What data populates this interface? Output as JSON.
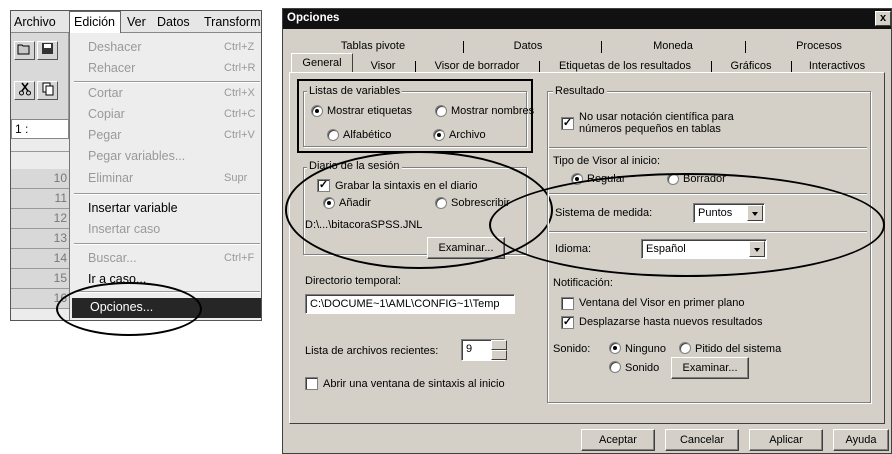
{
  "menubar": {
    "items": [
      "Archivo",
      "Edición",
      "Ver",
      "Datos",
      "Transform"
    ]
  },
  "toolbar_icons": [
    "open-folder-icon",
    "save-icon",
    "cut-icon",
    "copy-icon"
  ],
  "data_editor": {
    "cell_ref": "1 :",
    "row_numbers": [
      "10",
      "11",
      "12",
      "13",
      "14",
      "15",
      "16"
    ]
  },
  "edit_menu": {
    "items": [
      {
        "label": "Deshacer",
        "shortcut": "Ctrl+Z",
        "enabled": false
      },
      {
        "label": "Rehacer",
        "shortcut": "Ctrl+R",
        "enabled": false
      },
      {
        "label": "Cortar",
        "shortcut": "Ctrl+X",
        "enabled": false
      },
      {
        "label": "Copiar",
        "shortcut": "Ctrl+C",
        "enabled": false
      },
      {
        "label": "Pegar",
        "shortcut": "Ctrl+V",
        "enabled": false
      },
      {
        "label": "Pegar variables...",
        "shortcut": "",
        "enabled": false
      },
      {
        "label": "Eliminar",
        "shortcut": "Supr",
        "enabled": false
      },
      {
        "label": "Insertar variable",
        "shortcut": "",
        "enabled": true
      },
      {
        "label": "Insertar caso",
        "shortcut": "",
        "enabled": false
      },
      {
        "label": "Buscar...",
        "shortcut": "Ctrl+F",
        "enabled": false
      },
      {
        "label": "Ir a caso...",
        "shortcut": "",
        "enabled": true
      },
      {
        "label": "Opciones...",
        "shortcut": "",
        "enabled": true,
        "highlighted": true
      }
    ]
  },
  "dialog": {
    "title": "Opciones",
    "close_glyph": "x",
    "tabs_row1": [
      "Tablas pivote",
      "Datos",
      "Moneda",
      "Procesos"
    ],
    "tabs_row2": [
      "General",
      "Visor",
      "Visor de borrador",
      "Etiquetas de los resultados",
      "Gráficos",
      "Interactivos"
    ],
    "active_tab": "General",
    "variable_lists": {
      "title": "Listas de variables",
      "show_labels": "Mostrar etiquetas",
      "show_names": "Mostrar nombres",
      "alphabetical": "Alfabético",
      "file": "Archivo",
      "selected_display": "Mostrar etiquetas",
      "selected_order": "Archivo"
    },
    "session_journal": {
      "title": "Diario de la sesión",
      "record_syntax": "Grabar la sintaxis en el diario",
      "record_syntax_checked": true,
      "append": "Añadir",
      "overwrite": "Sobrescribir",
      "selected": "Añadir",
      "path": "D:\\...\\bitacoraSPSS.JNL",
      "browse": "Examinar..."
    },
    "temp_dir": {
      "label": "Directorio temporal:",
      "value": "C:\\DOCUME~1\\AML\\CONFIG~1\\Temp"
    },
    "recent_files": {
      "label": "Lista de archivos recientes:",
      "value": "9"
    },
    "open_syntax_at_start": {
      "label": "Abrir una ventana de sintaxis al inicio",
      "checked": false
    },
    "output": {
      "title": "Resultado",
      "no_sci_notation": "No usar notación científica para números pequeños en tablas",
      "no_sci_notation_checked": true,
      "viewer_type_label": "Tipo de Visor al inicio:",
      "viewer_regular": "Regular",
      "viewer_draft": "Borrador",
      "viewer_selected": "Regular",
      "measurement_label": "Sistema de medida:",
      "measurement_value": "Puntos",
      "language_label": "Idioma:",
      "language_value": "Español",
      "notification_label": "Notificación:",
      "popup_viewer": "Ventana del Visor en primer plano",
      "popup_viewer_checked": false,
      "scroll_to_output": "Desplazarse hasta nuevos resultados",
      "scroll_to_output_checked": true,
      "sound_label": "Sonido:",
      "sound_none": "Ninguno",
      "sound_system_beep": "Pitido del sistema",
      "sound_file": "Sonido",
      "sound_selected": "Ninguno",
      "sound_browse": "Examinar..."
    },
    "buttons": {
      "ok": "Aceptar",
      "cancel": "Cancelar",
      "apply": "Aplicar",
      "help": "Ayuda"
    }
  }
}
